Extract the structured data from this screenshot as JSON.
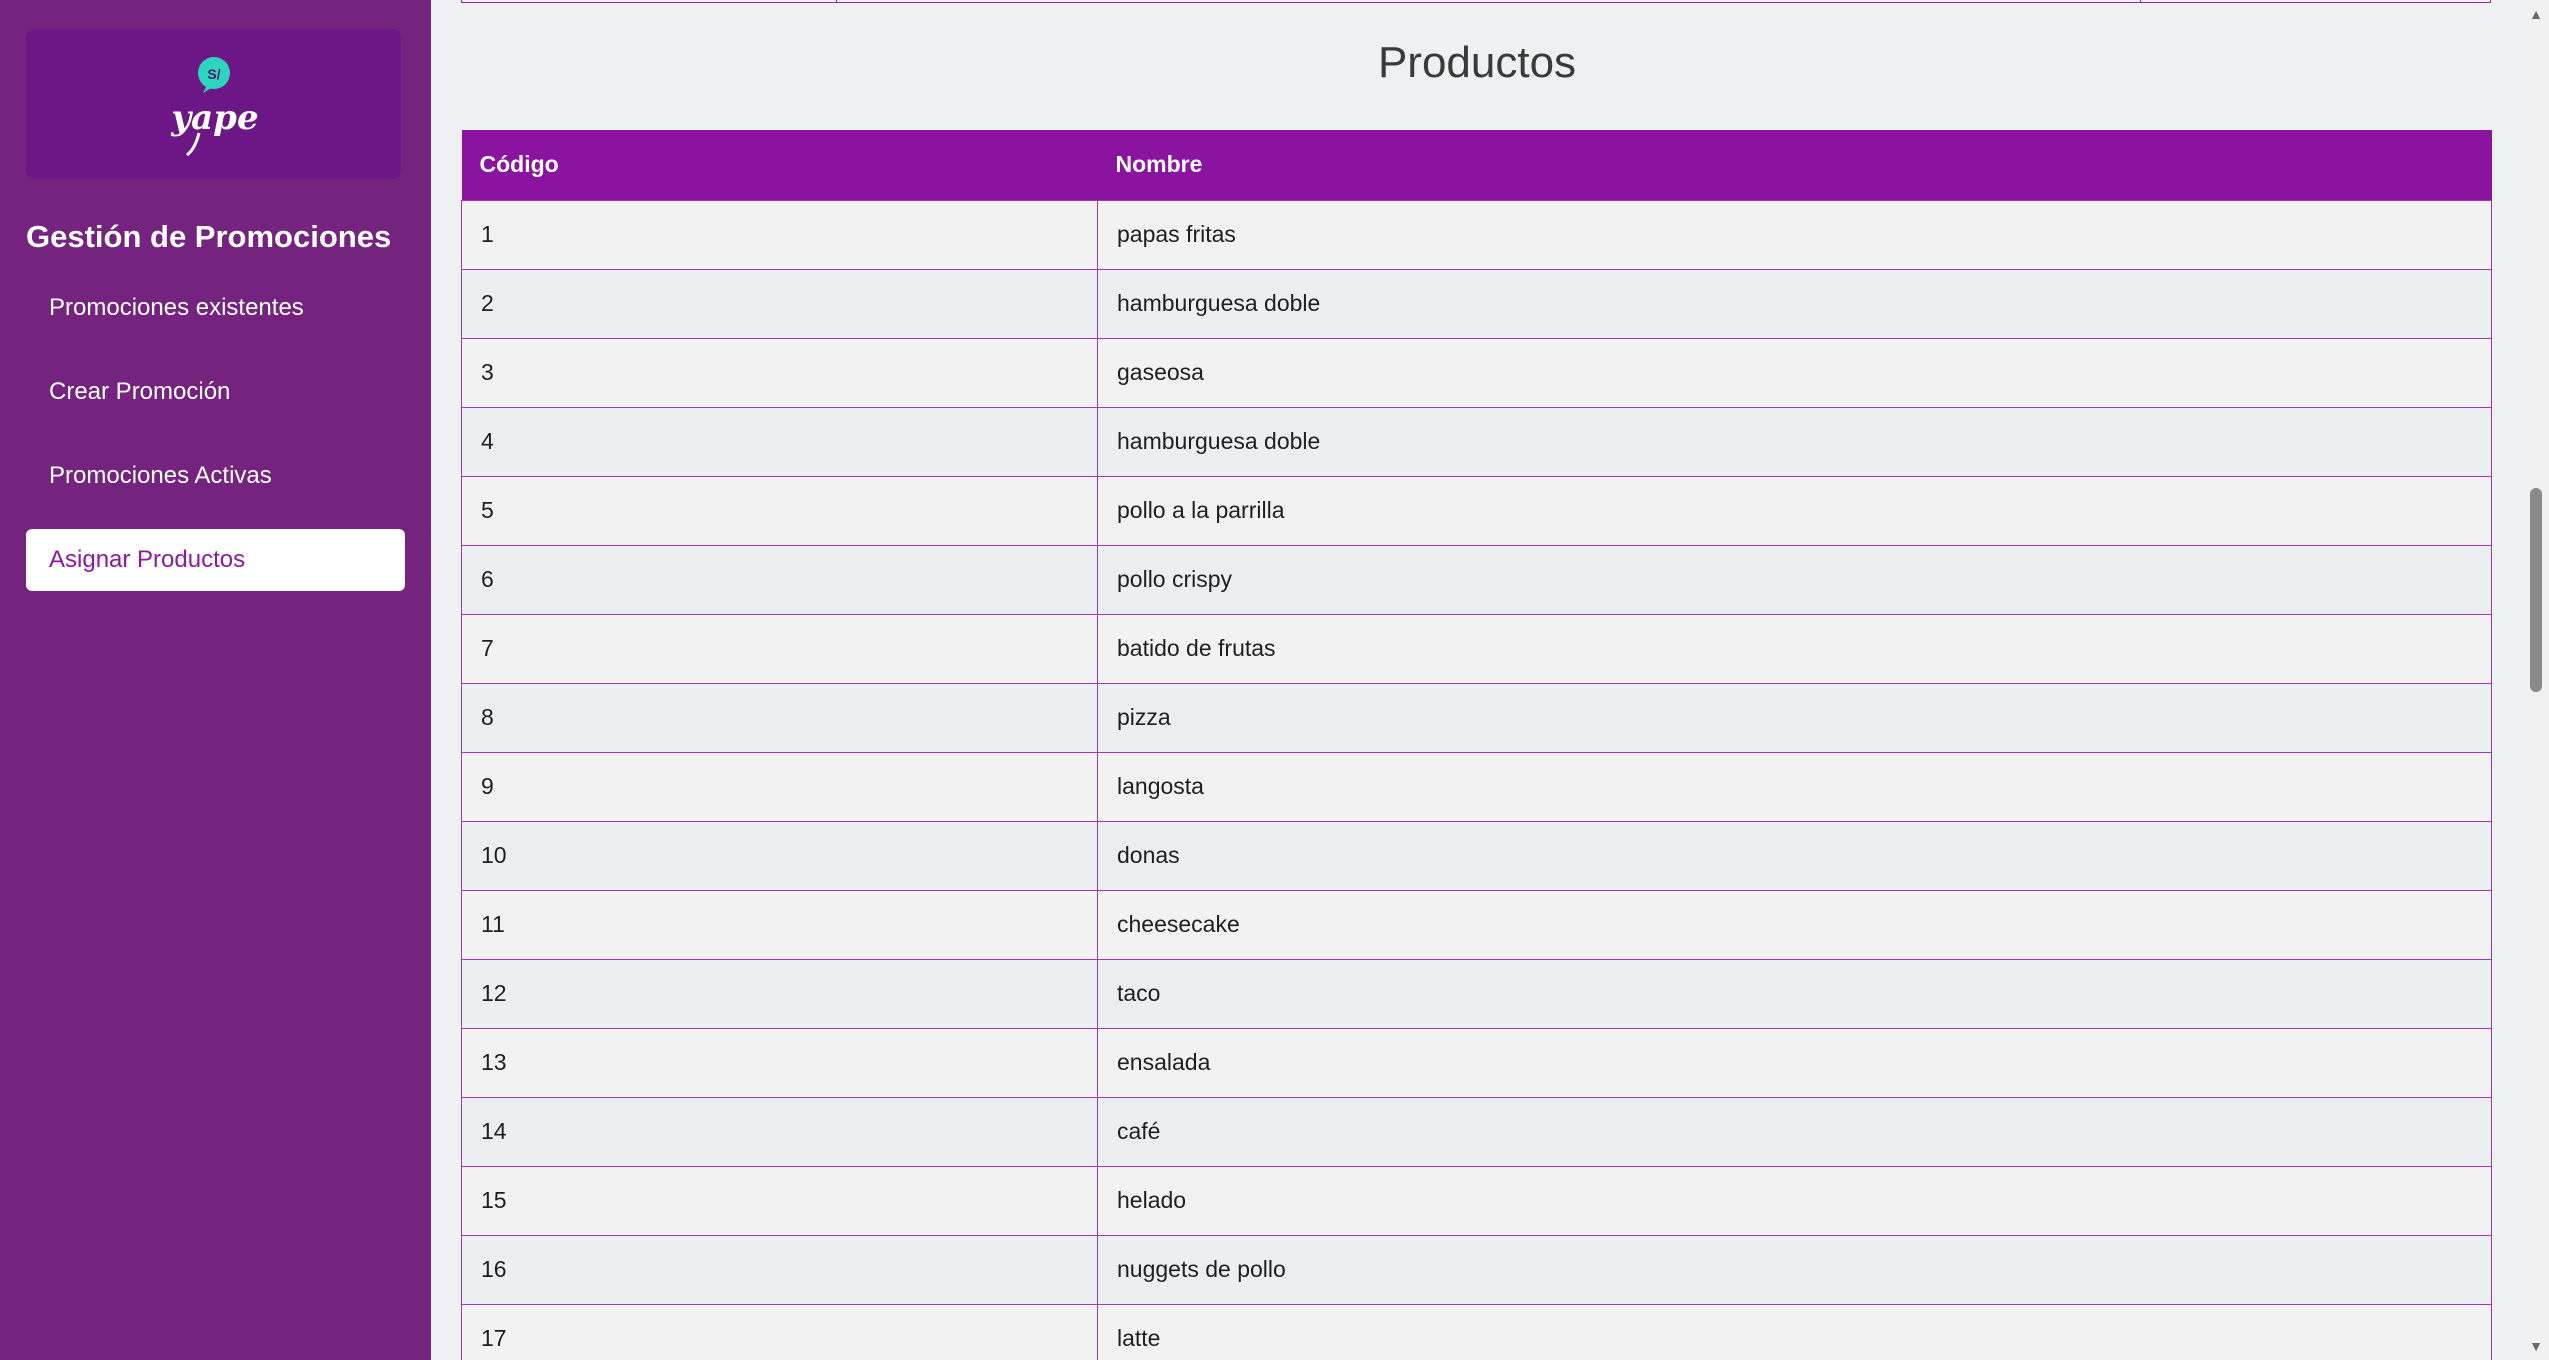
{
  "sidebar": {
    "logo_text": "yape",
    "title": "Gestión de Promociones",
    "items": [
      {
        "label": "Promociones existentes",
        "active": false
      },
      {
        "label": "Crear Promoción",
        "active": false
      },
      {
        "label": "Promociones Activas",
        "active": false
      },
      {
        "label": "Asignar Productos",
        "active": true
      }
    ]
  },
  "main": {
    "section_title": "Productos",
    "table": {
      "headers": [
        "Código",
        "Nombre"
      ],
      "rows": [
        [
          "1",
          "papas fritas"
        ],
        [
          "2",
          "hamburguesa doble"
        ],
        [
          "3",
          "gaseosa"
        ],
        [
          "4",
          "hamburguesa doble"
        ],
        [
          "5",
          "pollo a la parrilla"
        ],
        [
          "6",
          "pollo crispy"
        ],
        [
          "7",
          "batido de frutas"
        ],
        [
          "8",
          "pizza"
        ],
        [
          "9",
          "langosta"
        ],
        [
          "10",
          "donas"
        ],
        [
          "11",
          "cheesecake"
        ],
        [
          "12",
          "taco"
        ],
        [
          "13",
          "ensalada"
        ],
        [
          "14",
          "café"
        ],
        [
          "15",
          "helado"
        ],
        [
          "16",
          "nuggets de pollo"
        ],
        [
          "17",
          "latte"
        ]
      ]
    }
  },
  "colors": {
    "sidebar_bg": "#74237f",
    "logo_bg": "#6d1685",
    "table_header": "#8a13a0",
    "accent_text": "#8b1aa0",
    "logo_bubble": "#2dd4bf"
  },
  "icons": {
    "logo": "yape-logo-icon",
    "scroll_up": "scroll-up-arrow-icon",
    "scroll_down": "scroll-down-arrow-icon"
  }
}
